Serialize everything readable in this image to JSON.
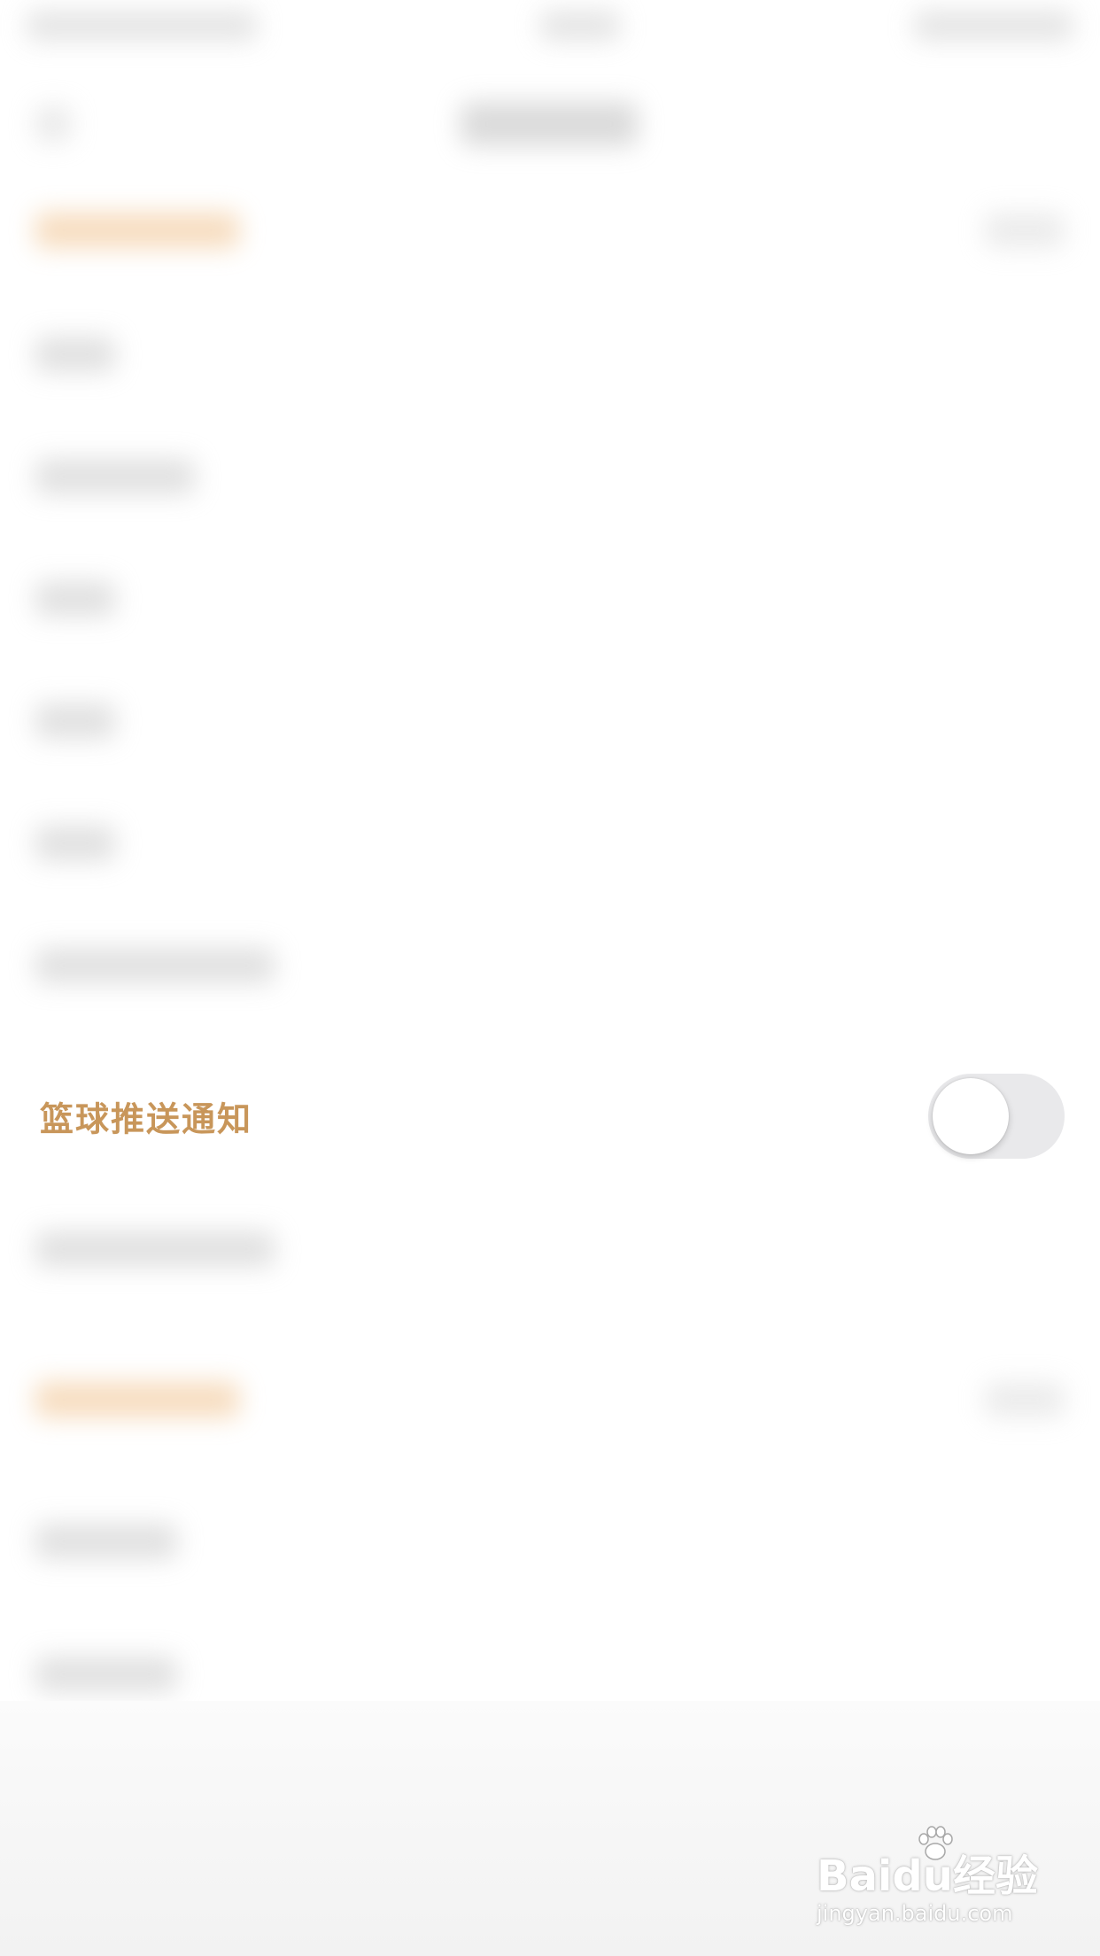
{
  "settings": {
    "basketball_push_label": "篮球推送通知",
    "basketball_push_enabled": false
  },
  "colors": {
    "accent_label": "#c8965a",
    "toggle_off": "#e9e9eb"
  },
  "watermark": {
    "brand": "Baidu经验",
    "url": "jingyan.baidu.com"
  }
}
